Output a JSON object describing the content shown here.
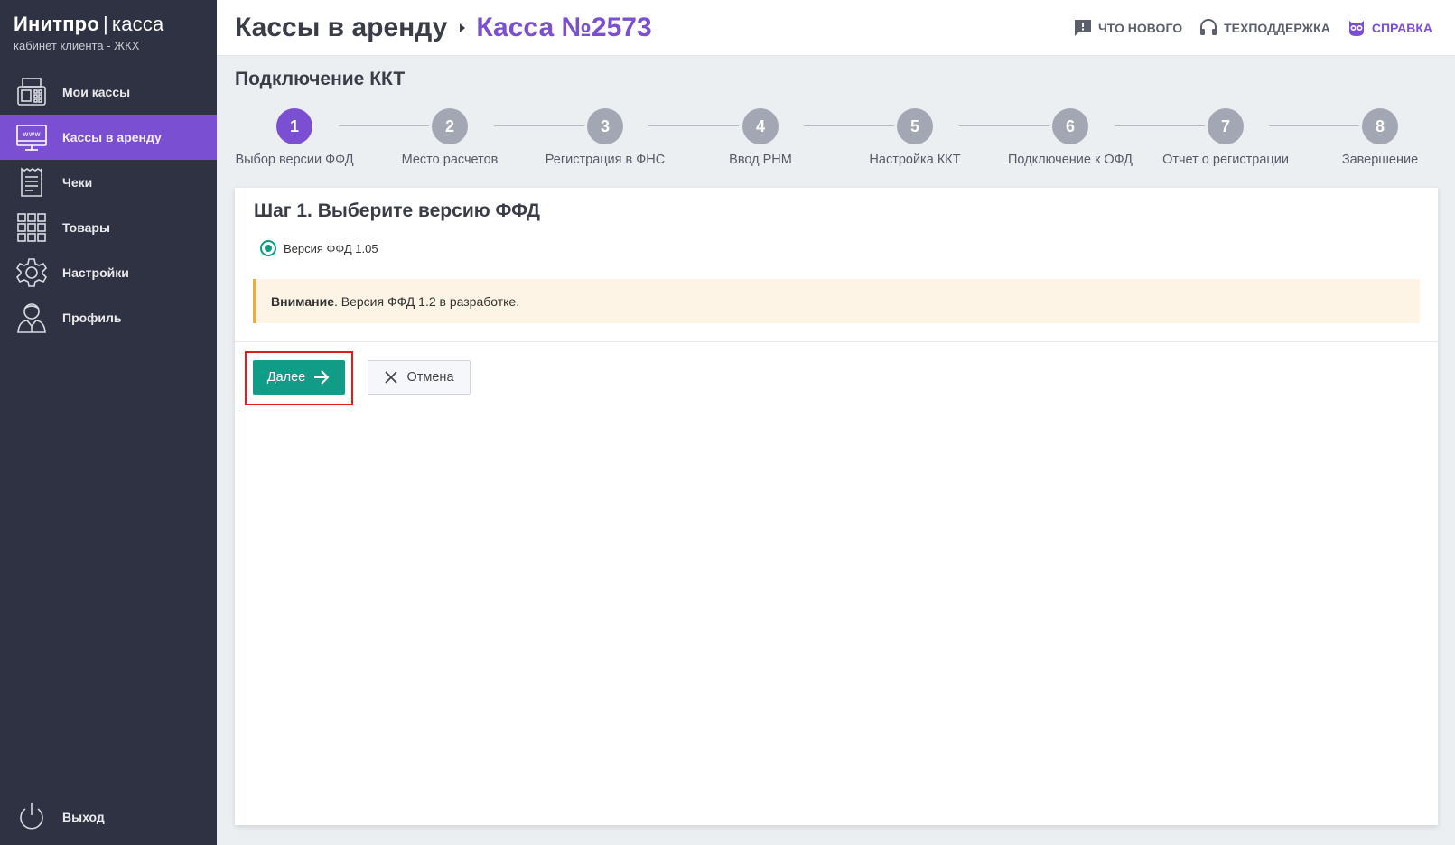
{
  "brand": {
    "name": "Инитпро",
    "separator": "|",
    "product": "касса",
    "subtitle": "кабинет клиента - ЖКХ"
  },
  "sidebar": {
    "items": [
      {
        "label": "Мои кассы",
        "icon": "cash-register-icon",
        "active": false
      },
      {
        "label": "Кассы в аренду",
        "icon": "monitor-www-icon",
        "active": true
      },
      {
        "label": "Чеки",
        "icon": "receipt-icon",
        "active": false
      },
      {
        "label": "Товары",
        "icon": "grid-icon",
        "active": false
      },
      {
        "label": "Настройки",
        "icon": "gear-icon",
        "active": false
      },
      {
        "label": "Профиль",
        "icon": "user-icon",
        "active": false
      }
    ],
    "logout_label": "Выход"
  },
  "header": {
    "breadcrumb_parent": "Кассы в аренду",
    "breadcrumb_current": "Касса №2573",
    "links": [
      {
        "label": "ЧТО НОВОГО",
        "icon": "news-icon"
      },
      {
        "label": "ТЕХПОДДЕРЖКА",
        "icon": "headset-icon"
      },
      {
        "label": "СПРАВКА",
        "icon": "owl-icon"
      }
    ]
  },
  "page": {
    "section_title": "Подключение ККТ"
  },
  "stepper": {
    "current": 1,
    "steps": [
      {
        "number": "1",
        "label": "Выбор версии ФФД"
      },
      {
        "number": "2",
        "label": "Место расчетов"
      },
      {
        "number": "3",
        "label": "Регистрация в ФНС"
      },
      {
        "number": "4",
        "label": "Ввод РНМ"
      },
      {
        "number": "5",
        "label": "Настройка ККТ"
      },
      {
        "number": "6",
        "label": "Подключение к ОФД"
      },
      {
        "number": "7",
        "label": "Отчет о регистрации"
      },
      {
        "number": "8",
        "label": "Завершение"
      }
    ]
  },
  "form": {
    "title": "Шаг 1. Выберите версию ФФД",
    "option_label": "Версия ФФД 1.05",
    "option_selected": true,
    "alert_strong": "Внимание",
    "alert_text": ". Версия ФФД 1.2 в разработке.",
    "next_label": "Далее",
    "cancel_label": "Отмена"
  },
  "colors": {
    "sidebar_bg": "#2f3242",
    "accent_purple": "#7b4fd1",
    "button_green": "#119c87",
    "alert_bg": "#fdf4e6",
    "alert_border": "#f0ac3a",
    "highlight_red": "#e21a1a"
  }
}
